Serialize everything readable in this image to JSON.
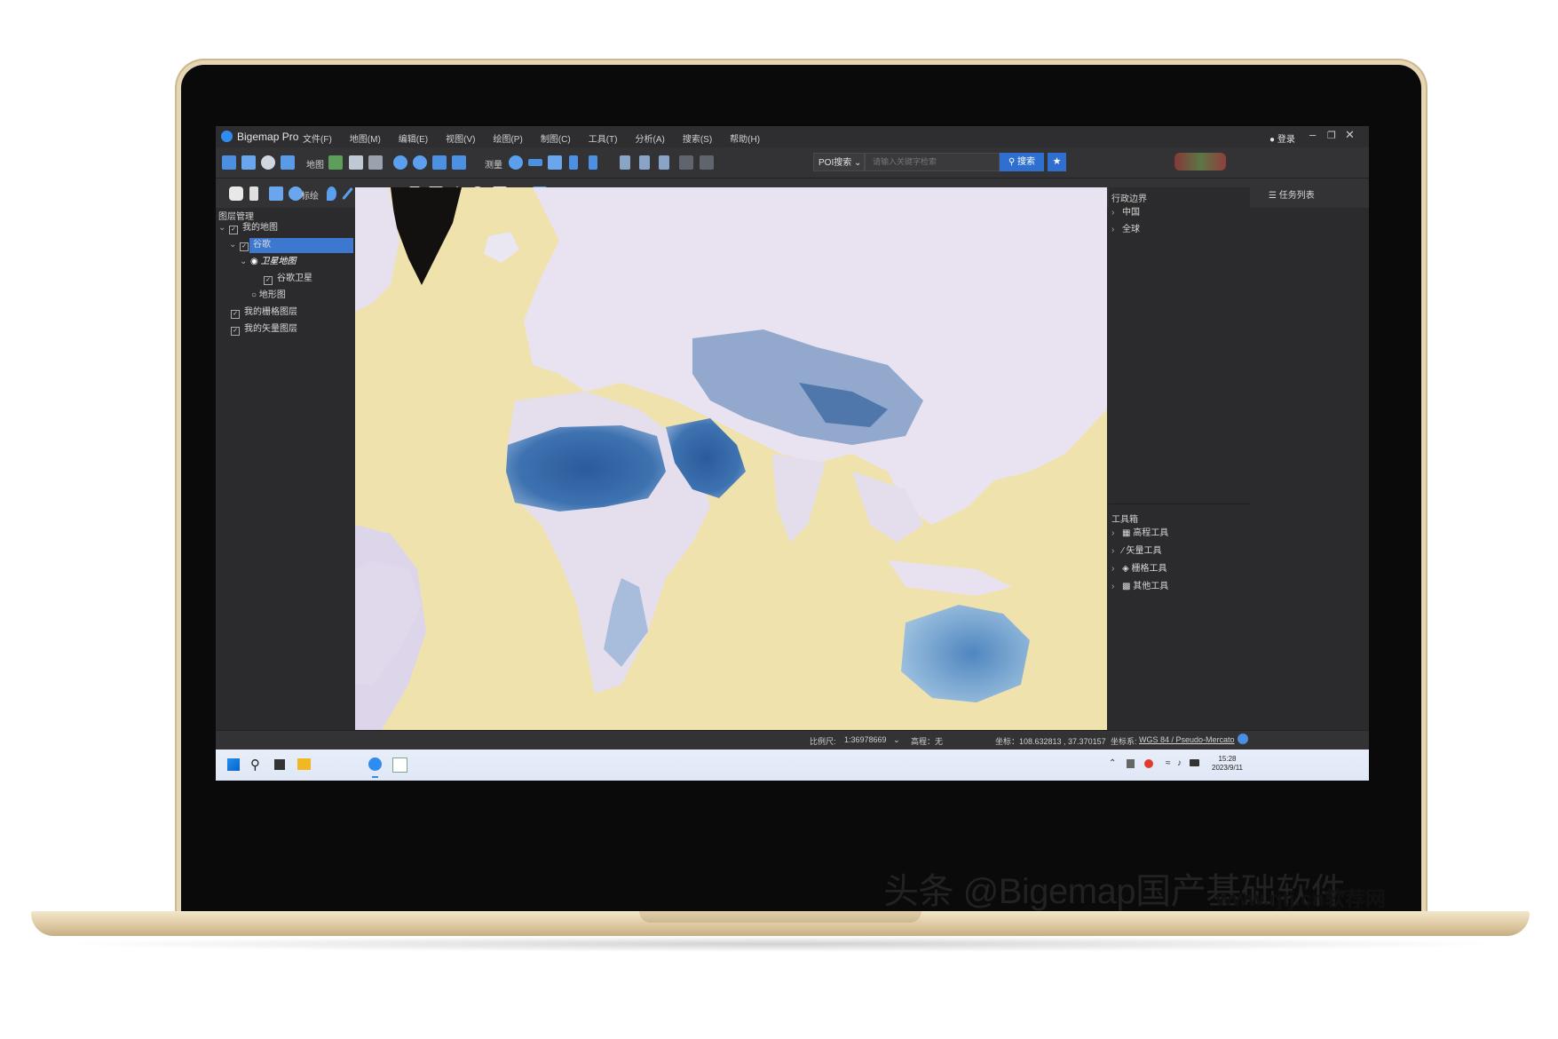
{
  "app": {
    "title": "Bigemap Pro",
    "menu": [
      "文件(F)",
      "地图(M)",
      "编辑(E)",
      "视图(V)",
      "绘图(P)",
      "制图(C)",
      "工具(T)",
      "分析(A)",
      "搜索(S)",
      "帮助(H)"
    ],
    "login_label": "登录"
  },
  "toolbar": {
    "map_label": "地图",
    "measure_label": "测量",
    "annotate_label": "标绘",
    "poi_select": "POI搜索",
    "search_placeholder": "请输入关键字检索",
    "search_button": "搜索",
    "task_list": "任务列表"
  },
  "layer_panel": {
    "title": "图层管理",
    "items": [
      "我的地图",
      "谷歌",
      "卫星地图",
      "谷歌卫星",
      "地形图",
      "我的栅格图层",
      "我的矢量图层"
    ]
  },
  "admin_panel": {
    "title": "行政边界",
    "items": [
      "中国",
      "全球"
    ]
  },
  "toolbox": {
    "title": "工具箱",
    "items": [
      "高程工具",
      "矢量工具",
      "栅格工具",
      "其他工具"
    ]
  },
  "statusbar": {
    "scale_label": "比例尺:",
    "scale_value": "1:36978669",
    "elevation": "高程：无",
    "coords": "坐标：108.632813 , 37.370157",
    "crs_label": "坐标系:",
    "crs_value": "WGS 84 / Pseudo-Mercato"
  },
  "taskbar": {
    "time": "15:28",
    "date": "2023/9/11"
  },
  "watermark": {
    "main": "头条 @Bigemap国产基础软件",
    "site": "www.rjtj.cn软荐网"
  },
  "colors": {
    "accent": "#2e6fd0",
    "selection": "#3c78d0",
    "bezel": "#0a0a0a",
    "laptop_gold": "#e7d6b4"
  }
}
